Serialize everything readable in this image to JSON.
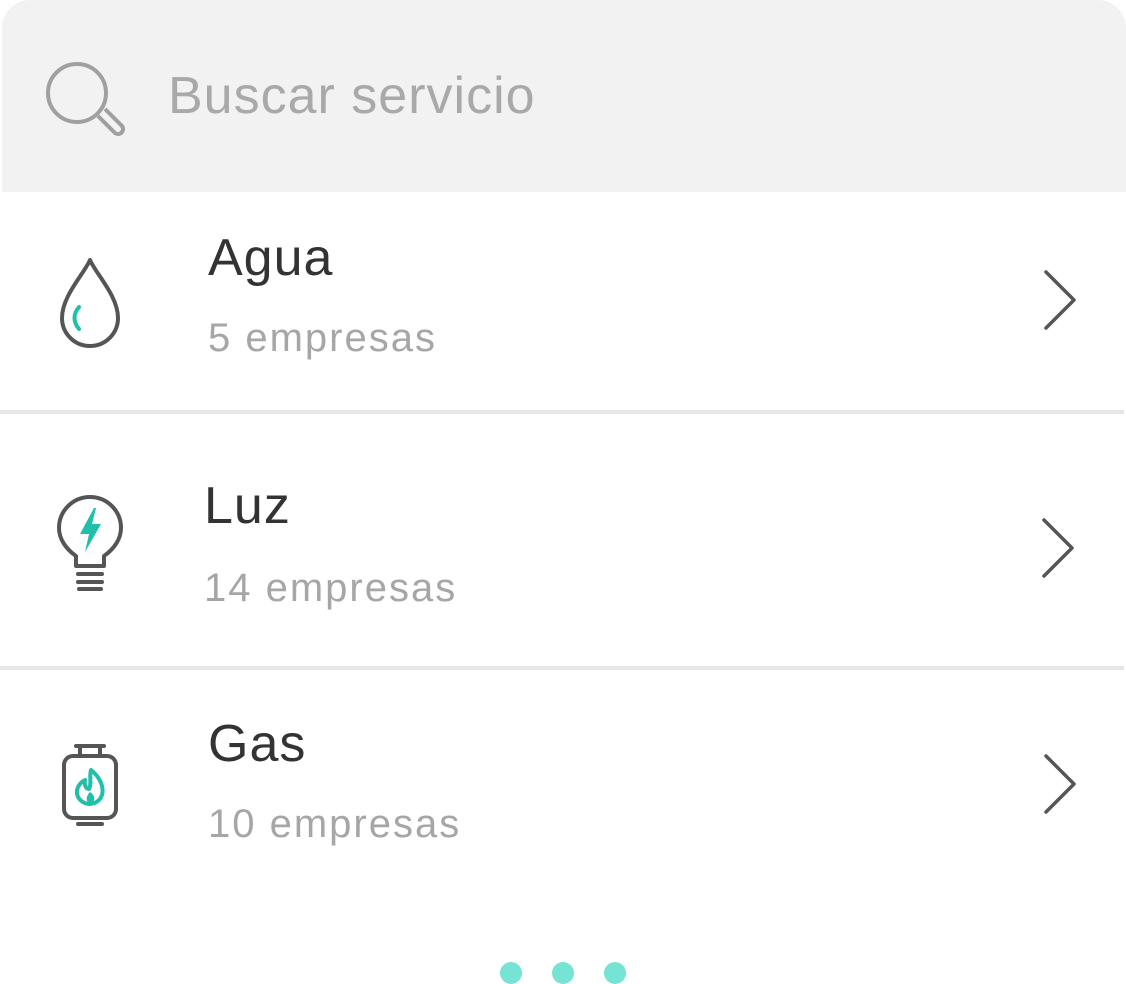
{
  "search": {
    "placeholder": "Buscar servicio",
    "value": "",
    "icon": "search-icon"
  },
  "services": [
    {
      "title": "Agua",
      "subtitle": "5 empresas",
      "icon": "water-drop-icon"
    },
    {
      "title": "Luz",
      "subtitle": "14 empresas",
      "icon": "lightbulb-icon"
    },
    {
      "title": "Gas",
      "subtitle": "10 empresas",
      "icon": "gas-cylinder-icon"
    }
  ],
  "colors": {
    "accent": "#1fbfa9",
    "pager_dot": "#76e4d4",
    "icon_stroke": "#555555",
    "search_bg": "#f2f2f2",
    "divider": "#e6e6e6"
  },
  "pager": {
    "dot_count": 3
  }
}
